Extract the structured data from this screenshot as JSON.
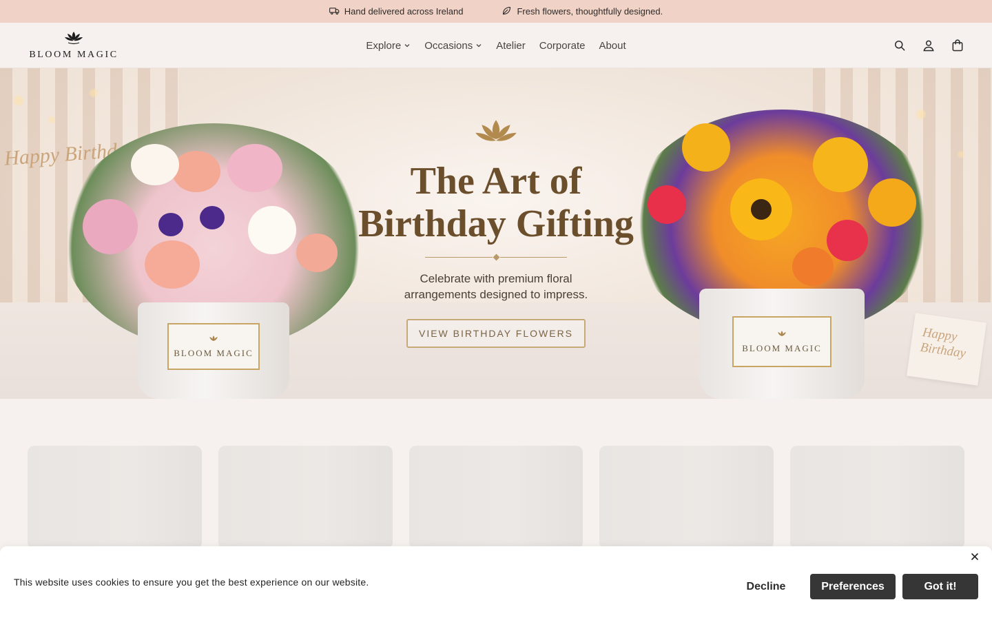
{
  "announcement": {
    "left_text": "Hand delivered across Ireland",
    "right_text": "Fresh flowers, thoughtfully designed.",
    "left_icon": "truck-icon",
    "right_icon": "leaf-icon"
  },
  "header": {
    "logo_text": "BLOOM MAGIC",
    "nav": [
      {
        "label": "Explore",
        "has_dropdown": true
      },
      {
        "label": "Occasions",
        "has_dropdown": true
      },
      {
        "label": "Atelier",
        "has_dropdown": false
      },
      {
        "label": "Corporate",
        "has_dropdown": false
      },
      {
        "label": "About",
        "has_dropdown": false
      }
    ],
    "icons": [
      "search-icon",
      "account-icon",
      "cart-icon"
    ]
  },
  "hero": {
    "title_line1": "The Art of",
    "title_line2": "Birthday Gifting",
    "subtitle": "Celebrate with premium floral arrangements designed to impress.",
    "cta": "VIEW BIRTHDAY FLOWERS",
    "box_label_left": "BLOOM MAGIC",
    "box_label_right": "BLOOM MAGIC",
    "sign_left": "Happy Birthday",
    "sign_right": "Happy Birthday"
  },
  "cookie": {
    "message": "This website uses cookies to ensure you get the best experience on our website.",
    "decline": "Decline",
    "preferences": "Preferences",
    "accept": "Got it!"
  },
  "colors": {
    "announcement_bg": "#f0d3c6",
    "page_bg": "#f6f1ee",
    "accent_gold": "#b89a6a",
    "button_dark": "#363636"
  }
}
